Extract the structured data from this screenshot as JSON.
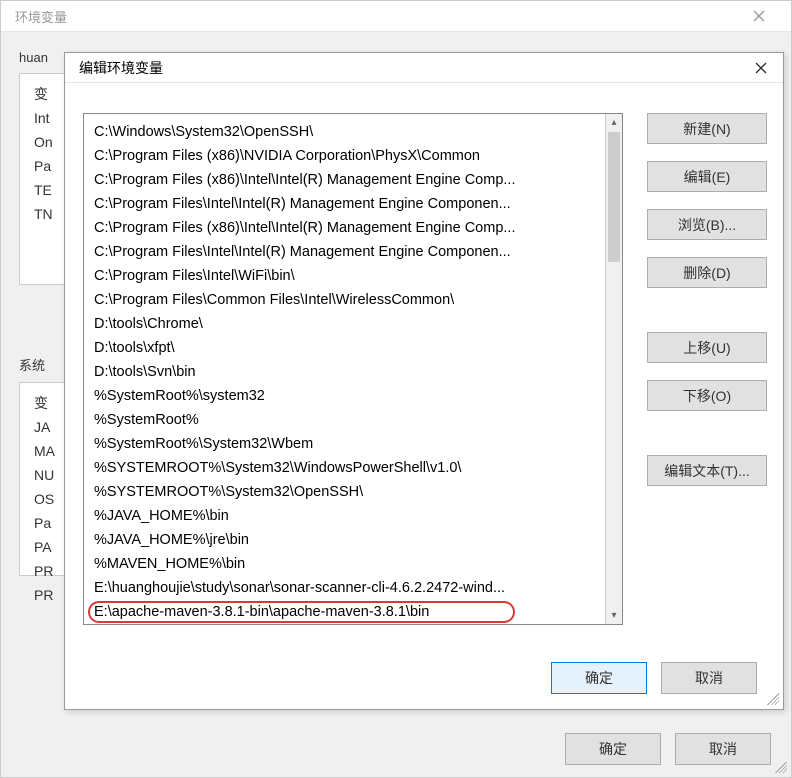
{
  "outerWindow": {
    "title": "环境变量",
    "userVarsLabel": "huan",
    "userVars": [
      "变",
      "Int",
      "On",
      "Pa",
      "TE",
      "TN"
    ],
    "sysVarsLabel": "系统",
    "sysVars": [
      "变",
      "JA",
      "MA",
      "NU",
      "OS",
      "Pa",
      "PA",
      "PR",
      "PR"
    ],
    "footer": {
      "ok": "确定",
      "cancel": "取消"
    }
  },
  "dialog": {
    "title": "编辑环境变量",
    "entries": [
      "C:\\Windows\\System32\\OpenSSH\\",
      "C:\\Program Files (x86)\\NVIDIA Corporation\\PhysX\\Common",
      "C:\\Program Files (x86)\\Intel\\Intel(R) Management Engine Comp...",
      "C:\\Program Files\\Intel\\Intel(R) Management Engine Componen...",
      "C:\\Program Files (x86)\\Intel\\Intel(R) Management Engine Comp...",
      "C:\\Program Files\\Intel\\Intel(R) Management Engine Componen...",
      "C:\\Program Files\\Intel\\WiFi\\bin\\",
      "C:\\Program Files\\Common Files\\Intel\\WirelessCommon\\",
      "D:\\tools\\Chrome\\",
      "D:\\tools\\xfpt\\",
      "D:\\tools\\Svn\\bin",
      "%SystemRoot%\\system32",
      "%SystemRoot%",
      "%SystemRoot%\\System32\\Wbem",
      "%SYSTEMROOT%\\System32\\WindowsPowerShell\\v1.0\\",
      "%SYSTEMROOT%\\System32\\OpenSSH\\",
      "%JAVA_HOME%\\bin",
      "%JAVA_HOME%\\jre\\bin",
      "%MAVEN_HOME%\\bin",
      "E:\\huanghoujie\\study\\sonar\\sonar-scanner-cli-4.6.2.2472-wind...",
      "E:\\apache-maven-3.8.1-bin\\apache-maven-3.8.1\\bin"
    ],
    "highlightedIndex": 20,
    "buttons": {
      "new": "新建(N)",
      "edit": "编辑(E)",
      "browse": "浏览(B)...",
      "delete": "删除(D)",
      "moveUp": "上移(U)",
      "moveDown": "下移(O)",
      "editText": "编辑文本(T)..."
    },
    "footer": {
      "ok": "确定",
      "cancel": "取消"
    }
  }
}
